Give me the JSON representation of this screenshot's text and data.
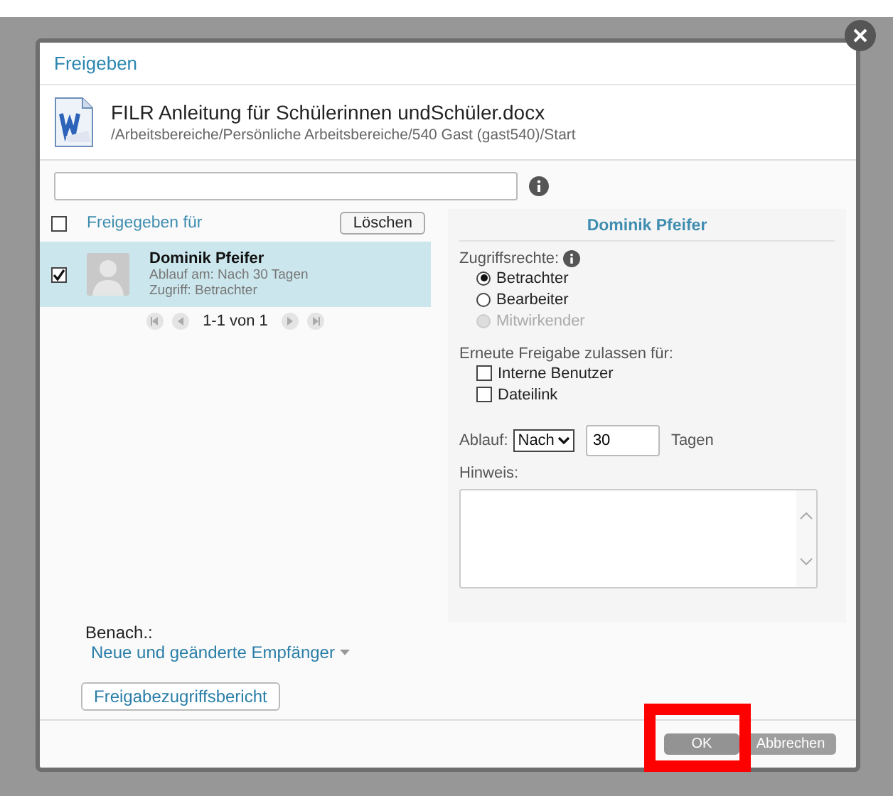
{
  "dialog": {
    "title": "Freigeben"
  },
  "file": {
    "name": "FILR Anleitung für Schülerinnen undSchüler.docx",
    "path": "/Arbeitsbereiche/Persönliche Arbeitsbereiche/540 Gast (gast540)/Start"
  },
  "list": {
    "header": "Freigegeben für",
    "header_checked": false,
    "delete_button": "Löschen",
    "recipients": [
      {
        "name": "Dominik Pfeifer",
        "expiry": "Ablauf am: Nach 30 Tagen",
        "access": "Zugriff: Betrachter",
        "checked": true,
        "selected": true
      }
    ],
    "pager": "1-1 von 1"
  },
  "details": {
    "title": "Dominik Pfeifer",
    "access_label": "Zugriffsrechte:",
    "access_options": [
      {
        "label": "Betrachter",
        "selected": true,
        "disabled": false
      },
      {
        "label": "Bearbeiter",
        "selected": false,
        "disabled": false
      },
      {
        "label": "Mitwirkender",
        "selected": false,
        "disabled": true
      }
    ],
    "reshare_label": "Erneute Freigabe zulassen für:",
    "reshare_options": [
      {
        "label": "Interne Benutzer",
        "checked": false
      },
      {
        "label": "Dateilink",
        "checked": false
      }
    ],
    "expiry_label": "Ablauf:",
    "expiry_mode": "Nach",
    "expiry_days": "30",
    "expiry_unit": "Tagen",
    "note_label": "Hinweis:"
  },
  "notify": {
    "label": "Benach.:",
    "value": "Neue und geänderte Empfänger"
  },
  "report_button": "Freigabezugriffsbericht",
  "buttons": [
    {
      "label": "OK",
      "kind": "primary"
    },
    {
      "label": "Abbrechen",
      "kind": "secondary"
    }
  ]
}
